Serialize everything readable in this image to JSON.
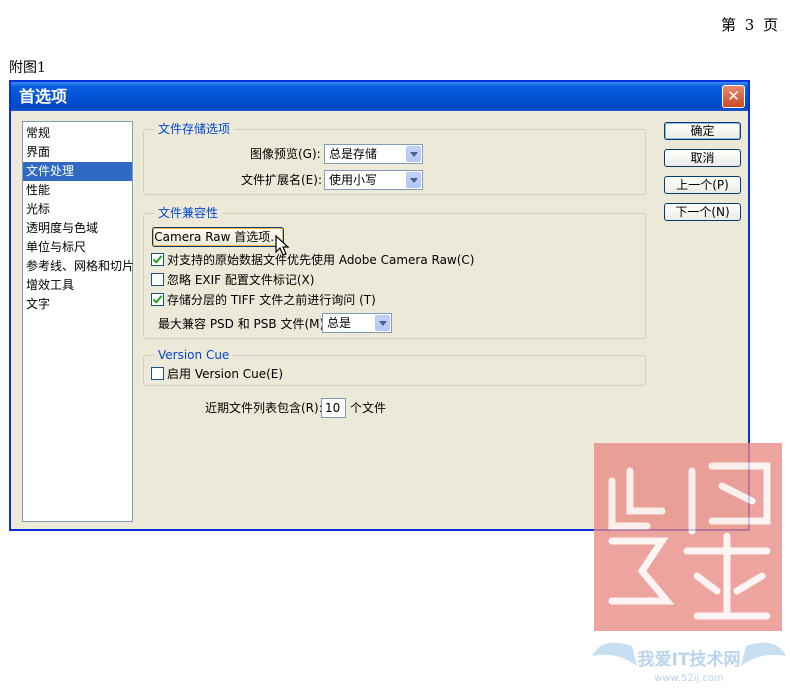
{
  "page": {
    "page_number": "第 3 页",
    "figure_caption": "附图1"
  },
  "dialog": {
    "title": "首选项",
    "close_glyph": "✕",
    "categories": [
      "常规",
      "界面",
      "文件处理",
      "性能",
      "光标",
      "透明度与色域",
      "单位与标尺",
      "参考线、网格和切片",
      "增效工具",
      "文字"
    ],
    "selected_category": "文件处理",
    "file_save": {
      "title": "文件存储选项",
      "preview_label": "图像预览(G):",
      "preview_value": "总是存储",
      "extension_label": "文件扩展名(E):",
      "extension_value": "使用小写"
    },
    "compat": {
      "title": "文件兼容性",
      "camera_raw_button": "Camera Raw 首选项...",
      "prefer_acr_label": "对支持的原始数据文件优先使用 Adobe Camera Raw(C)",
      "prefer_acr_checked": true,
      "ignore_exif_label": "忽略 EXIF 配置文件标记(X)",
      "ignore_exif_checked": false,
      "ask_tiff_label": "存储分层的 TIFF 文件之前进行询问 (T)",
      "ask_tiff_checked": true,
      "max_compat_label": "最大兼容 PSD 和 PSB 文件(M):",
      "max_compat_value": "总是"
    },
    "version_cue": {
      "title": "Version Cue",
      "enable_label": "启用 Version Cue(E)",
      "enable_checked": false
    },
    "recent": {
      "label": "近期文件列表包含(R):",
      "value": "10",
      "suffix": "个文件"
    },
    "buttons": {
      "ok": "确定",
      "cancel": "取消",
      "prev": "上一个(P)",
      "next": "下一个(N)"
    }
  },
  "watermark": {
    "site_name": "我爱IT技术网",
    "site_url": "www.52ij.com"
  },
  "colors": {
    "titlebar": "#0353d6",
    "dialog_bg": "#ece9d8",
    "selection": "#316ac5",
    "group_title": "#0046d5",
    "watermark_red": "#d9413a"
  }
}
